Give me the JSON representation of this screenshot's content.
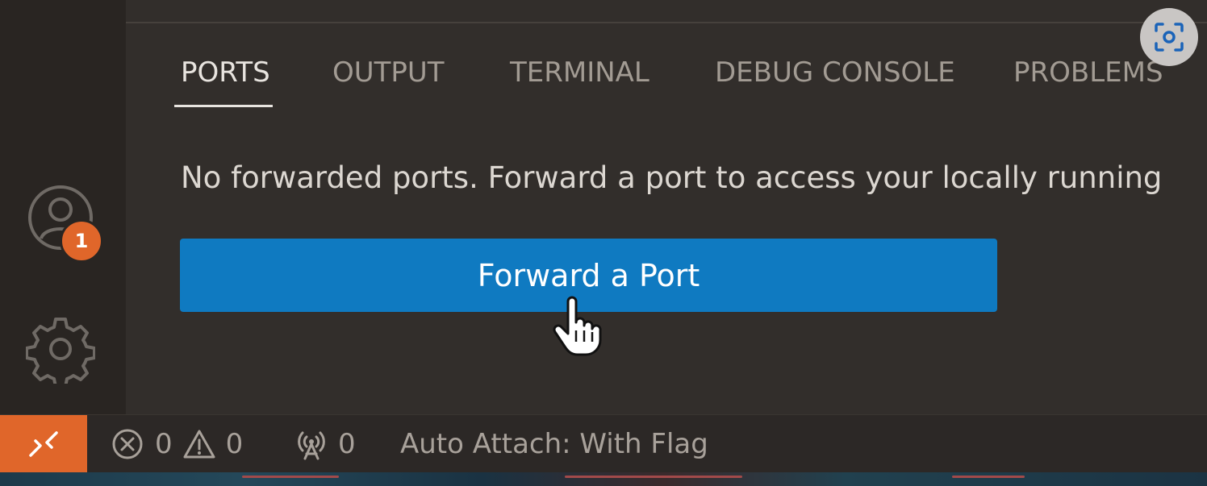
{
  "activity_bar": {
    "account_badge": "1",
    "icons": {
      "account": "account-icon",
      "settings": "gear-icon"
    }
  },
  "panel": {
    "tabs": [
      {
        "label": "PORTS",
        "active": true
      },
      {
        "label": "OUTPUT",
        "active": false
      },
      {
        "label": "TERMINAL",
        "active": false
      },
      {
        "label": "DEBUG CONSOLE",
        "active": false
      },
      {
        "label": "PROBLEMS",
        "active": false
      }
    ],
    "message": "No forwarded ports. Forward a port to access your locally running",
    "primary_button": "Forward a Port"
  },
  "status_bar": {
    "remote_icon": "remote-icon",
    "errors": "0",
    "warnings": "0",
    "ports": "0",
    "auto_attach": "Auto Attach: With Flag"
  },
  "colors": {
    "accent_orange": "#e0662a",
    "button_blue": "#0f7ac1",
    "panel_bg": "#322e2b",
    "sidebar_bg": "#292522"
  }
}
